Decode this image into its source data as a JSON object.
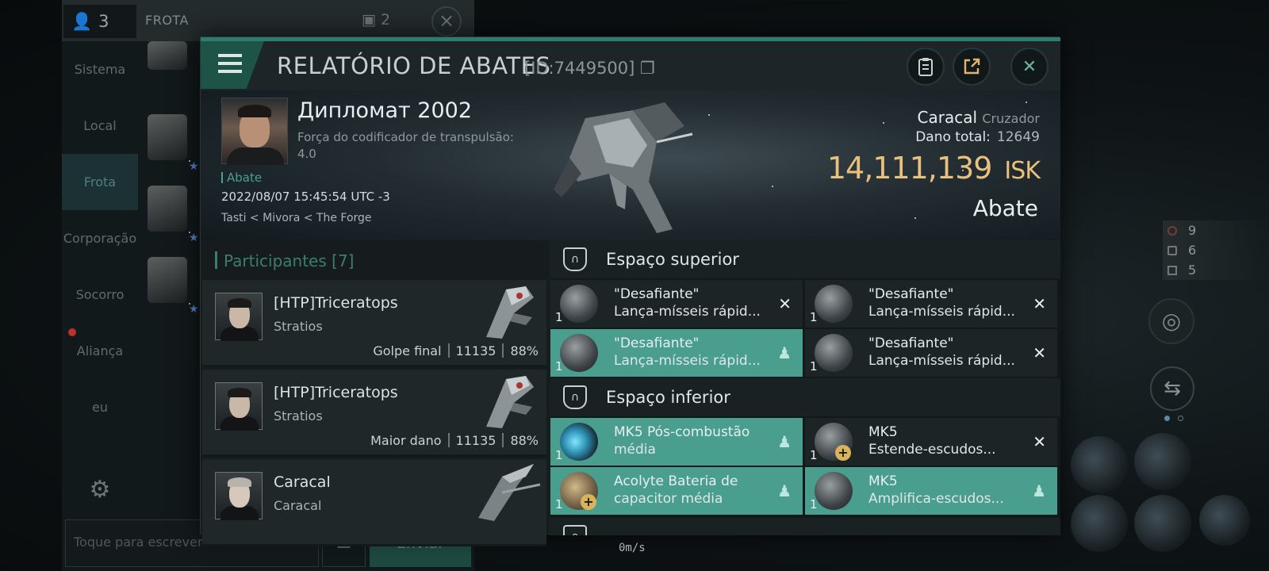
{
  "left": {
    "members_count": "3",
    "header_label": "FROTA",
    "member_slots": "2",
    "nav": [
      "Sistema",
      "Local",
      "Frota",
      "Corporação",
      "Socorro",
      "Aliança",
      "eu"
    ],
    "nav_active": "Frota",
    "chat_placeholder": "Toque para escrever",
    "send_label": "Enviar"
  },
  "hud": {
    "stat1": "9",
    "stat2": "6",
    "stat3": "5",
    "speed": "0m/s"
  },
  "report": {
    "title": "RELATÓRIO DE ABATES",
    "id": "[ID:7449500]",
    "victim": {
      "name": "Дипломат 2002",
      "corp_line": "Força do codificador de transpulsão: 4.0",
      "tag": "Abate",
      "date": "2022/08/07 15:45:54 UTC -3",
      "location": "Tasti < Mivora < The Forge"
    },
    "value": {
      "ship": "Caracal",
      "ship_class": "Cruzador",
      "damage_label": "Dano total:",
      "damage": "12649",
      "isk_amount": "14,111,139",
      "isk_unit": "ISK",
      "result": "Abate"
    },
    "participants_header": "Participantes [7]",
    "participants": [
      {
        "name": "[HTP]Triceratops",
        "ship": "Stratios",
        "label": "Golpe final",
        "damage": "11135",
        "pct": "88%"
      },
      {
        "name": "[HTP]Triceratops",
        "ship": "Stratios",
        "label": "Maior dano",
        "damage": "11135",
        "pct": "88%"
      },
      {
        "name": "Caracal",
        "ship": "Caracal",
        "label": "",
        "damage": "",
        "pct": ""
      }
    ],
    "sections": {
      "high": "Espaço superior",
      "low": "Espaço inferior"
    },
    "high_items": [
      {
        "qty": "1",
        "line1": "\"Desafiante\"",
        "line2": "Lança-mísseis rápid...",
        "status": "destroyed"
      },
      {
        "qty": "1",
        "line1": "\"Desafiante\"",
        "line2": "Lança-mísseis rápid...",
        "status": "destroyed"
      },
      {
        "qty": "1",
        "line1": "\"Desafiante\"",
        "line2": "Lança-mísseis rápid...",
        "status": "dropped"
      },
      {
        "qty": "1",
        "line1": "\"Desafiante\"",
        "line2": "Lança-mísseis rápid...",
        "status": "destroyed"
      }
    ],
    "low_items": [
      {
        "qty": "1",
        "line1": "MK5 Pós-combustão",
        "line2": "média",
        "status": "dropped"
      },
      {
        "qty": "1",
        "line1": "MK5",
        "line2": "Estende-escudos...",
        "status": "destroyed"
      },
      {
        "qty": "1",
        "line1": "Acolyte Bateria de",
        "line2": "capacitor média",
        "status": "dropped"
      },
      {
        "qty": "1",
        "line1": "MK5",
        "line2": "Amplifica-escudos...",
        "status": "dropped"
      }
    ],
    "colors": {
      "accent": "#4a9e8e",
      "isk": "#e9c07e"
    }
  }
}
